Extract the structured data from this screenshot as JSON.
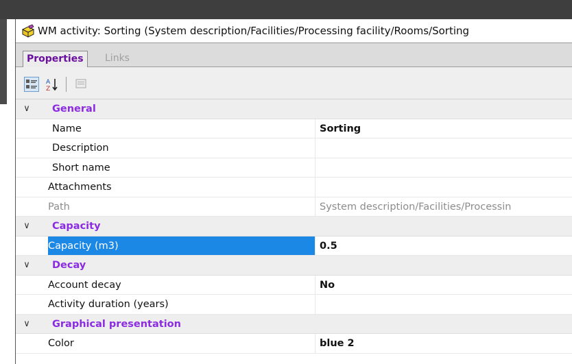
{
  "window": {
    "title": "WM activity: Sorting  (System description/Facilities/Processing facility/Rooms/Sorting"
  },
  "tabs": [
    {
      "label": "Properties",
      "active": true
    },
    {
      "label": "Links",
      "active": false
    }
  ],
  "toolbar": {
    "buttons": [
      "categorized-view-icon",
      "alphabetical-sort-icon",
      "property-pages-icon"
    ]
  },
  "properties": {
    "general": {
      "header": "General",
      "name_label": "Name",
      "name_value": "Sorting",
      "description_label": "Description",
      "description_value": "",
      "short_name_label": "Short name",
      "short_name_value": "",
      "attachments_label": "Attachments",
      "attachments_value": "",
      "path_label": "Path",
      "path_value": "System description/Facilities/Processin"
    },
    "capacity": {
      "header": "Capacity",
      "capacity_label": "Capacity (m3)",
      "capacity_value": "0.5"
    },
    "decay": {
      "header": "Decay",
      "account_decay_label": "Account decay",
      "account_decay_value": "No",
      "activity_duration_label": "Activity duration (years)",
      "activity_duration_value": ""
    },
    "graphical": {
      "header": "Graphical presentation",
      "color_label": "Color",
      "color_value": "blue 2"
    }
  },
  "colors": {
    "category_text": "#8b2be2",
    "selection": "#1c88e6",
    "active_tab_text": "#6b0f9e"
  }
}
